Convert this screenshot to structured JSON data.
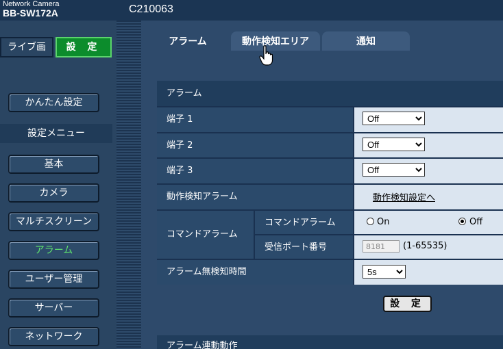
{
  "header": {
    "brand_line1": "Network Camera",
    "brand_line2": "BB-SW172A",
    "camera_name": "C210063"
  },
  "mode": {
    "live_label": "ライブ画",
    "setup_label": "設 定"
  },
  "sidebar": {
    "quick_setup": "かんたん設定",
    "menu_header": "設定メニュー",
    "items": [
      {
        "label": "基本"
      },
      {
        "label": "カメラ"
      },
      {
        "label": "マルチスクリーン"
      },
      {
        "label": "アラーム"
      },
      {
        "label": "ユーザー管理"
      },
      {
        "label": "サーバー"
      },
      {
        "label": "ネットワーク"
      }
    ]
  },
  "tabs": [
    {
      "label": "アラーム"
    },
    {
      "label": "動作検知エリア"
    },
    {
      "label": "通知"
    }
  ],
  "alarm": {
    "section_title": "アラーム",
    "terminal1_label": "端子 1",
    "terminal1_value": "Off",
    "terminal2_label": "端子 2",
    "terminal2_value": "Off",
    "terminal3_label": "端子 3",
    "terminal3_value": "Off",
    "motion_alarm_label": "動作検知アラーム",
    "motion_link": "動作検知設定へ",
    "command_alarm_group": "コマンドアラーム",
    "command_alarm_label": "コマンドアラーム",
    "radio_on": "On",
    "radio_off": "Off",
    "selected": "Off",
    "port_label": "受信ポート番号",
    "port_value": "8181",
    "port_range": "(1-65535)",
    "no_detect_label": "アラーム無検知時間",
    "no_detect_value": "5s",
    "set_button": "設 定",
    "next_section": "アラーム連動動作"
  }
}
